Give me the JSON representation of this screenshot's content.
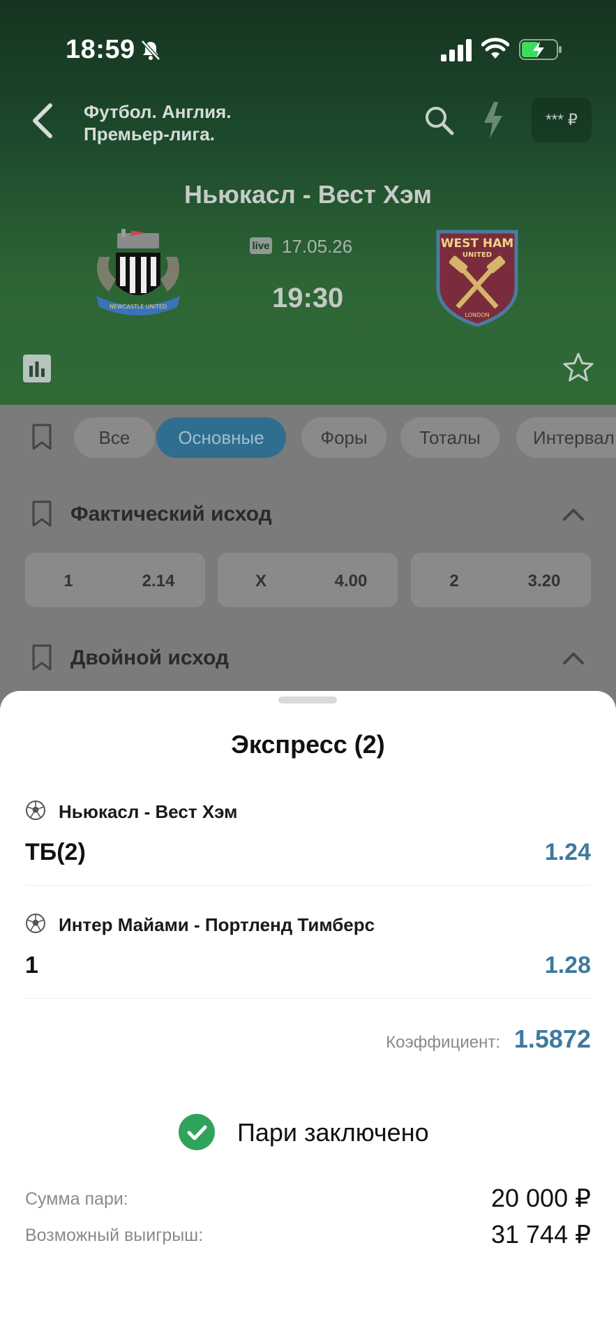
{
  "status_bar": {
    "time": "18:59",
    "icons": [
      "bell-muted-icon",
      "signal-icon",
      "wifi-icon",
      "battery-charging-icon"
    ]
  },
  "header": {
    "league_line1": "Футбол. Англия.",
    "league_line2": "Премьер-лига.",
    "balance": "*** ₽",
    "match_title": "Ньюкасл - Вест Хэм",
    "live_badge": "live",
    "date": "17.05.26",
    "time": "19:30",
    "home_team_logo": "newcastle-united-crest",
    "away_team_logo": "west-ham-united-crest",
    "away_logo_text": {
      "line1": "WEST HAM",
      "line2": "UNITED",
      "line3": "LONDON"
    },
    "home_logo_text": "NEWCASTLE UNITED"
  },
  "tabs": [
    "Все",
    "Основные",
    "Форы",
    "Тоталы",
    "Интервал"
  ],
  "active_tab": "Основные",
  "markets": {
    "actual_outcome": {
      "title": "Фактический исход",
      "odds": [
        {
          "label": "1",
          "value": "2.14"
        },
        {
          "label": "X",
          "value": "4.00"
        },
        {
          "label": "2",
          "value": "3.20"
        }
      ]
    },
    "double_outcome": {
      "title": "Двойной исход"
    }
  },
  "betslip": {
    "title": "Экспресс (2)",
    "bets": [
      {
        "event": "Ньюкасл - Вест Хэм",
        "selection": "ТБ(2)",
        "odd": "1.24"
      },
      {
        "event": "Интер Майами - Портленд Тимберс",
        "selection": "1",
        "odd": "1.28"
      }
    ],
    "coefficient_label": "Коэффициент:",
    "coefficient_value": "1.5872",
    "success_message": "Пари заключено",
    "stake_label": "Сумма пари:",
    "stake_value": "20 000 ₽",
    "payout_label": "Возможный выигрыш:",
    "payout_value": "31 744 ₽"
  },
  "colors": {
    "header_green": "#1d4a2c",
    "accent_blue": "#3d7a9e",
    "success_green": "#2fa35a"
  }
}
